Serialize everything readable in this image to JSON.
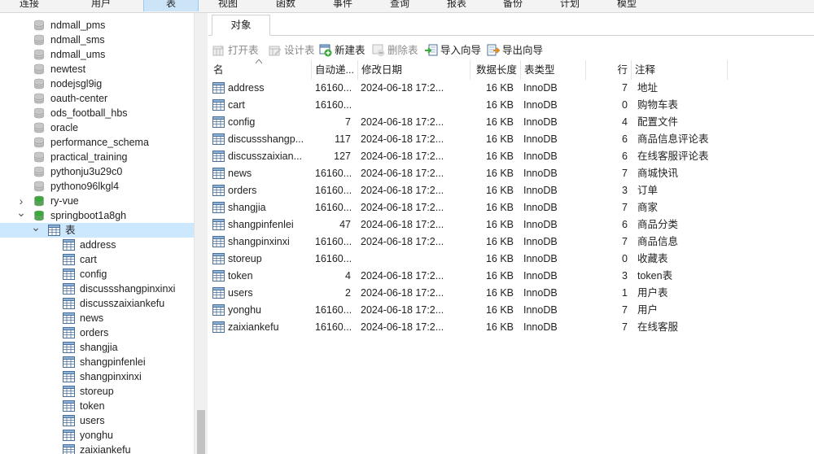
{
  "menu": [
    {
      "label": "连接",
      "active": false
    },
    {
      "label": "用户",
      "active": false
    },
    {
      "label": "表",
      "active": true
    },
    {
      "label": "视图",
      "active": false
    },
    {
      "label": "函数",
      "active": false
    },
    {
      "label": "事件",
      "active": false
    },
    {
      "label": "查询",
      "active": false
    },
    {
      "label": "报表",
      "active": false
    },
    {
      "label": "备份",
      "active": false
    },
    {
      "label": "计划",
      "active": false
    },
    {
      "label": "模型",
      "active": false
    }
  ],
  "tree": {
    "databases": [
      {
        "label": "ndmall_pms",
        "state": "closed"
      },
      {
        "label": "ndmall_sms",
        "state": "closed"
      },
      {
        "label": "ndmall_ums",
        "state": "closed"
      },
      {
        "label": "newtest",
        "state": "closed"
      },
      {
        "label": "nodejsgl9ig",
        "state": "closed"
      },
      {
        "label": "oauth-center",
        "state": "closed"
      },
      {
        "label": "ods_football_hbs",
        "state": "closed"
      },
      {
        "label": "oracle",
        "state": "closed"
      },
      {
        "label": "performance_schema",
        "state": "closed"
      },
      {
        "label": "practical_training",
        "state": "closed"
      },
      {
        "label": "pythonju3u29c0",
        "state": "closed"
      },
      {
        "label": "pythono96lkgl4",
        "state": "closed"
      },
      {
        "label": "ry-vue",
        "state": "open-collapsed"
      },
      {
        "label": "springboot1a8gh",
        "state": "open-expanded"
      }
    ],
    "tables_folder": "表",
    "tables": [
      "address",
      "cart",
      "config",
      "discussshangpinxinxi",
      "discusszaixiankefu",
      "news",
      "orders",
      "shangjia",
      "shangpinfenlei",
      "shangpinxinxi",
      "storeup",
      "token",
      "users",
      "yonghu",
      "zaixiankefu"
    ]
  },
  "object_tab": "对象",
  "toolbar": [
    {
      "label": "打开表",
      "icon": "open-table-icon",
      "disabled": true
    },
    {
      "label": "设计表",
      "icon": "design-table-icon",
      "disabled": true
    },
    {
      "label": "新建表",
      "icon": "new-table-icon",
      "disabled": false
    },
    {
      "label": "删除表",
      "icon": "delete-table-icon",
      "disabled": true
    },
    {
      "label": "导入向导",
      "icon": "import-wizard-icon",
      "disabled": false
    },
    {
      "label": "导出向导",
      "icon": "export-wizard-icon",
      "disabled": false
    }
  ],
  "columns": [
    "名",
    "自动递...",
    "修改日期",
    "数据长度",
    "表类型",
    "行",
    "注释"
  ],
  "rows": [
    {
      "name": "address",
      "auto": "16160...",
      "date": "2024-06-18 17:2...",
      "size": "16 KB",
      "engine": "InnoDB",
      "rows": "7",
      "comment": "地址"
    },
    {
      "name": "cart",
      "auto": "16160...",
      "date": "",
      "size": "16 KB",
      "engine": "InnoDB",
      "rows": "0",
      "comment": "购物车表"
    },
    {
      "name": "config",
      "auto": "7",
      "date": "2024-06-18 17:2...",
      "size": "16 KB",
      "engine": "InnoDB",
      "rows": "4",
      "comment": "配置文件"
    },
    {
      "name": "discussshangp...",
      "auto": "117",
      "date": "2024-06-18 17:2...",
      "size": "16 KB",
      "engine": "InnoDB",
      "rows": "6",
      "comment": "商品信息评论表"
    },
    {
      "name": "discusszaixian...",
      "auto": "127",
      "date": "2024-06-18 17:2...",
      "size": "16 KB",
      "engine": "InnoDB",
      "rows": "6",
      "comment": "在线客服评论表"
    },
    {
      "name": "news",
      "auto": "16160...",
      "date": "2024-06-18 17:2...",
      "size": "16 KB",
      "engine": "InnoDB",
      "rows": "7",
      "comment": "商城快讯"
    },
    {
      "name": "orders",
      "auto": "16160...",
      "date": "2024-06-18 17:2...",
      "size": "16 KB",
      "engine": "InnoDB",
      "rows": "3",
      "comment": "订单"
    },
    {
      "name": "shangjia",
      "auto": "16160...",
      "date": "2024-06-18 17:2...",
      "size": "16 KB",
      "engine": "InnoDB",
      "rows": "7",
      "comment": "商家"
    },
    {
      "name": "shangpinfenlei",
      "auto": "47",
      "date": "2024-06-18 17:2...",
      "size": "16 KB",
      "engine": "InnoDB",
      "rows": "6",
      "comment": "商品分类"
    },
    {
      "name": "shangpinxinxi",
      "auto": "16160...",
      "date": "2024-06-18 17:2...",
      "size": "16 KB",
      "engine": "InnoDB",
      "rows": "7",
      "comment": "商品信息"
    },
    {
      "name": "storeup",
      "auto": "16160...",
      "date": "",
      "size": "16 KB",
      "engine": "InnoDB",
      "rows": "0",
      "comment": "收藏表"
    },
    {
      "name": "token",
      "auto": "4",
      "date": "2024-06-18 17:2...",
      "size": "16 KB",
      "engine": "InnoDB",
      "rows": "3",
      "comment": "token表"
    },
    {
      "name": "users",
      "auto": "2",
      "date": "2024-06-18 17:2...",
      "size": "16 KB",
      "engine": "InnoDB",
      "rows": "1",
      "comment": "用户表"
    },
    {
      "name": "yonghu",
      "auto": "16160...",
      "date": "2024-06-18 17:2...",
      "size": "16 KB",
      "engine": "InnoDB",
      "rows": "7",
      "comment": "用户"
    },
    {
      "name": "zaixiankefu",
      "auto": "16160...",
      "date": "2024-06-18 17:2...",
      "size": "16 KB",
      "engine": "InnoDB",
      "rows": "7",
      "comment": "在线客服"
    }
  ],
  "colors": {
    "selection": "#cce8ff",
    "menu_active": "#cce4f7",
    "db_icon": "#c8c8c8",
    "db_icon_active": "#3aa83a"
  }
}
